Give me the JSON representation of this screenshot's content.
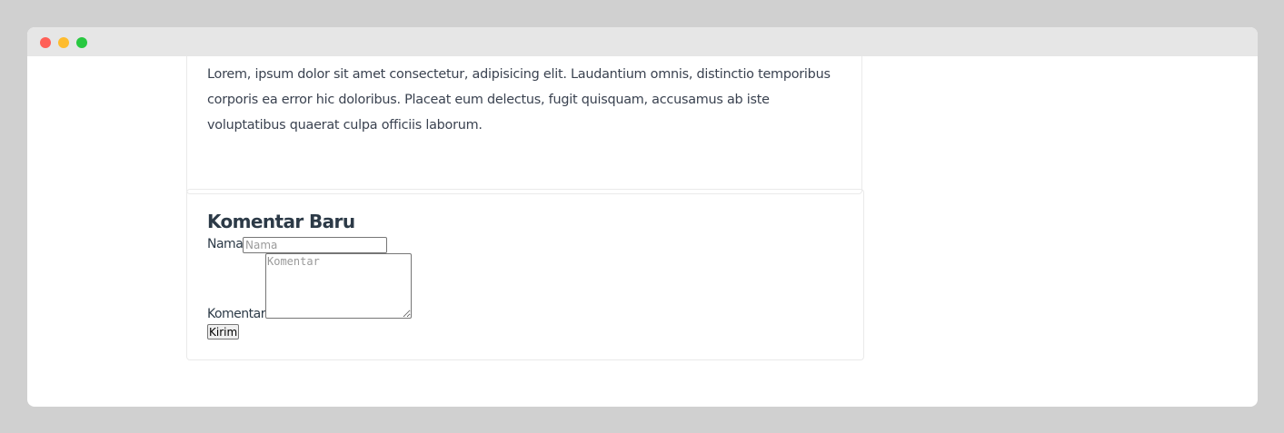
{
  "window": {
    "controls": {
      "close_color": "#ff5f57",
      "minimize_color": "#febc2e",
      "maximize_color": "#28c840"
    }
  },
  "post": {
    "body": "Lorem, ipsum dolor sit amet consectetur, adipisicing elit. Laudantium omnis, distinctio temporibus corporis ea error hic doloribus. Placeat eum delectus, fugit quisquam, accusamus ab iste voluptatibus quaerat culpa officiis laborum."
  },
  "comment_form": {
    "title": "Komentar Baru",
    "name_label": "Nama",
    "name_placeholder": "Nama",
    "comment_label": "Komentar",
    "comment_placeholder": "Komentar",
    "submit_label": "Kirim"
  }
}
